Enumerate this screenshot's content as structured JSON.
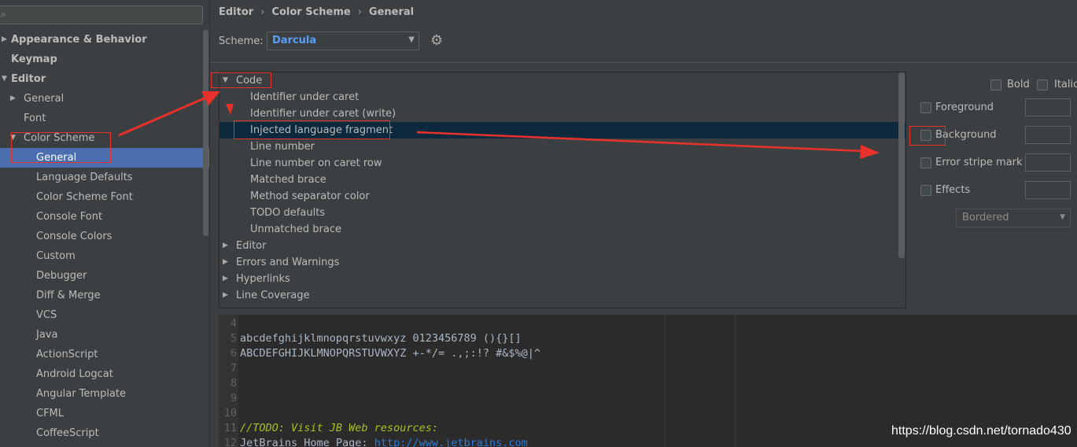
{
  "sidebar": {
    "search": {
      "placeholder": "",
      "value": ""
    },
    "items": [
      {
        "label": "Appearance & Behavior",
        "level": 0,
        "arrow": "collapsed",
        "bold": true
      },
      {
        "label": "Keymap",
        "level": 0,
        "arrow": "",
        "bold": true
      },
      {
        "label": "Editor",
        "level": 0,
        "arrow": "expanded",
        "bold": true
      },
      {
        "label": "General",
        "level": 1,
        "arrow": "collapsed"
      },
      {
        "label": "Font",
        "level": 1,
        "arrow": ""
      },
      {
        "label": "Color Scheme",
        "level": 1,
        "arrow": "expanded"
      },
      {
        "label": "General",
        "level": 2,
        "arrow": "",
        "selected": true
      },
      {
        "label": "Language Defaults",
        "level": 2,
        "arrow": ""
      },
      {
        "label": "Color Scheme Font",
        "level": 2,
        "arrow": ""
      },
      {
        "label": "Console Font",
        "level": 2,
        "arrow": ""
      },
      {
        "label": "Console Colors",
        "level": 2,
        "arrow": ""
      },
      {
        "label": "Custom",
        "level": 2,
        "arrow": ""
      },
      {
        "label": "Debugger",
        "level": 2,
        "arrow": ""
      },
      {
        "label": "Diff & Merge",
        "level": 2,
        "arrow": ""
      },
      {
        "label": "VCS",
        "level": 2,
        "arrow": ""
      },
      {
        "label": "Java",
        "level": 2,
        "arrow": ""
      },
      {
        "label": "ActionScript",
        "level": 2,
        "arrow": ""
      },
      {
        "label": "Android Logcat",
        "level": 2,
        "arrow": ""
      },
      {
        "label": "Angular Template",
        "level": 2,
        "arrow": ""
      },
      {
        "label": "CFML",
        "level": 2,
        "arrow": ""
      },
      {
        "label": "CoffeeScript",
        "level": 2,
        "arrow": ""
      }
    ]
  },
  "breadcrumb": [
    "Editor",
    "Color Scheme",
    "General"
  ],
  "scheme": {
    "label": "Scheme:",
    "value": "Darcula"
  },
  "code_tree": [
    {
      "label": "Code",
      "level": 0,
      "arrow": "expanded"
    },
    {
      "label": "Identifier under caret",
      "level": 1
    },
    {
      "label": "Identifier under caret (write)",
      "level": 1
    },
    {
      "label": "Injected language fragment",
      "level": 1,
      "selected": true
    },
    {
      "label": "Line number",
      "level": 1
    },
    {
      "label": "Line number on caret row",
      "level": 1
    },
    {
      "label": "Matched brace",
      "level": 1
    },
    {
      "label": "Method separator color",
      "level": 1
    },
    {
      "label": "TODO defaults",
      "level": 1
    },
    {
      "label": "Unmatched brace",
      "level": 1
    },
    {
      "label": "Editor",
      "level": 0,
      "arrow": "collapsed"
    },
    {
      "label": "Errors and Warnings",
      "level": 0,
      "arrow": "collapsed"
    },
    {
      "label": "Hyperlinks",
      "level": 0,
      "arrow": "collapsed"
    },
    {
      "label": "Line Coverage",
      "level": 0,
      "arrow": "collapsed"
    }
  ],
  "attributes": {
    "bold_label": "Bold",
    "italic_label": "Italic",
    "foreground_label": "Foreground",
    "background_label": "Background",
    "error_stripe_label": "Error stripe mark",
    "effects_label": "Effects",
    "effects_value": "Bordered"
  },
  "preview": {
    "lines": [
      {
        "num": "4",
        "text": ""
      },
      {
        "num": "5",
        "text": "abcdefghijklmnopqrstuvwxyz 0123456789 (){}[]"
      },
      {
        "num": "6",
        "text": "ABCDEFGHIJKLMNOPQRSTUVWXYZ +-*/= .,;:!? #&$%@|^"
      },
      {
        "num": "7",
        "text": ""
      },
      {
        "num": "8",
        "text": ""
      },
      {
        "num": "9",
        "text": ""
      },
      {
        "num": "10",
        "text": ""
      },
      {
        "num": "11",
        "text": "//TODO: Visit JB Web resources:"
      },
      {
        "num": "12",
        "text": "JetBrains Home Page: "
      }
    ],
    "url": "http://www.jetbrains.com"
  },
  "watermark": "https://blog.csdn.net/tornado430",
  "colors": {
    "selection": "#4b6eaf",
    "tree_selection": "#0d293e",
    "annotation": "#e8312a",
    "scheme_value": "#589df6",
    "todo": "#a8c023",
    "url": "#287bde"
  }
}
